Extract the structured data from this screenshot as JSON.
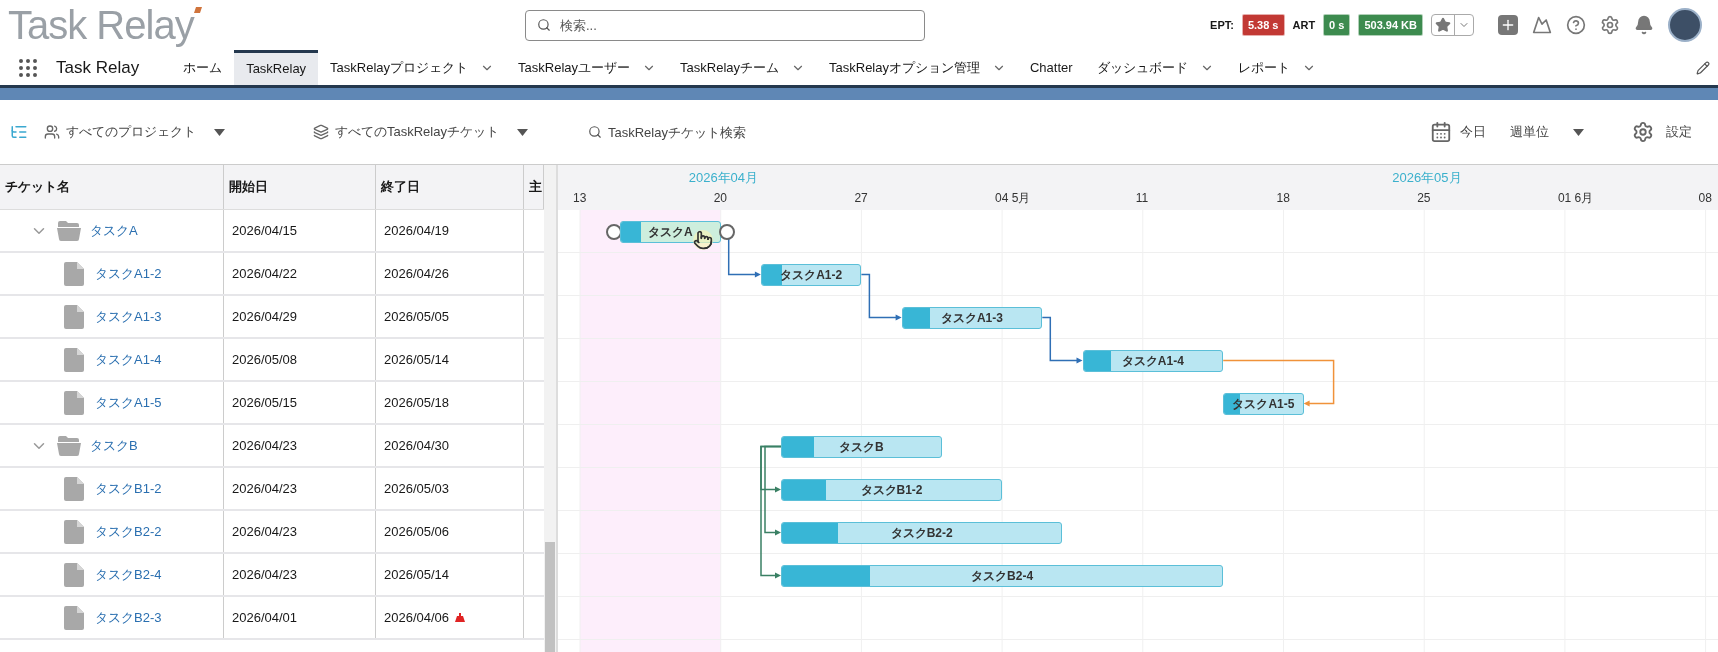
{
  "header": {
    "logo": "Task Relay",
    "search": {
      "placeholder": "検索..."
    },
    "metrics": [
      {
        "label": "EPT:",
        "value": "5.38 s",
        "color": "#c23934"
      },
      {
        "label": "ART",
        "value": "0 s",
        "color": "#3d8b4f"
      },
      {
        "value": "503.94 KB",
        "color": "#3d8b4f"
      }
    ]
  },
  "nav": {
    "app_name": "Task Relay",
    "items": [
      {
        "label": "ホーム",
        "selected": false,
        "has_menu": false
      },
      {
        "label": "TaskRelay",
        "selected": true,
        "has_menu": false
      },
      {
        "label": "TaskRelayプロジェクト",
        "selected": false,
        "has_menu": true
      },
      {
        "label": "TaskRelayユーザー",
        "selected": false,
        "has_menu": true
      },
      {
        "label": "TaskRelayチーム",
        "selected": false,
        "has_menu": true
      },
      {
        "label": "TaskRelayオプション管理",
        "selected": false,
        "has_menu": true
      },
      {
        "label": "Chatter",
        "selected": false,
        "has_menu": false
      },
      {
        "label": "ダッシュボード",
        "selected": false,
        "has_menu": true
      },
      {
        "label": "レポート",
        "selected": false,
        "has_menu": true
      }
    ]
  },
  "toolbar": {
    "project_filter": "すべてのプロジェクト",
    "ticket_filter": "すべてのTaskRelayチケット",
    "search": {
      "placeholder": "TaskRelayチケット検索"
    },
    "today": "今日",
    "scale": "週単位",
    "settings": "設定"
  },
  "table": {
    "columns": [
      "チケット名",
      "開始日",
      "終了日",
      "主"
    ],
    "rows": [
      {
        "name": "タスクA",
        "start": "2026/04/15",
        "end": "2026/04/19",
        "overdue": false,
        "expanded": true,
        "children": [
          {
            "name": "タスクA1-2",
            "start": "2026/04/22",
            "end": "2026/04/26",
            "overdue": false
          },
          {
            "name": "タスクA1-3",
            "start": "2026/04/29",
            "end": "2026/05/05",
            "overdue": false
          },
          {
            "name": "タスクA1-4",
            "start": "2026/05/08",
            "end": "2026/05/14",
            "overdue": false
          },
          {
            "name": "タスクA1-5",
            "start": "2026/05/15",
            "end": "2026/05/18",
            "overdue": false
          }
        ]
      },
      {
        "name": "タスクB",
        "start": "2026/04/23",
        "end": "2026/04/30",
        "overdue": false,
        "expanded": true,
        "children": [
          {
            "name": "タスクB1-2",
            "start": "2026/04/23",
            "end": "2026/05/03",
            "overdue": false
          },
          {
            "name": "タスクB2-2",
            "start": "2026/04/23",
            "end": "2026/05/06",
            "overdue": false
          },
          {
            "name": "タスクB2-4",
            "start": "2026/04/23",
            "end": "2026/05/14",
            "overdue": false
          },
          {
            "name": "タスクB2-3",
            "start": "2026/04/01",
            "end": "2026/04/06",
            "overdue": true
          }
        ]
      }
    ]
  },
  "gantt": {
    "months": [
      "2026年04月",
      "2026年05月"
    ],
    "weeks": [
      "13",
      "20",
      "27",
      "04 5月",
      "11",
      "18",
      "25",
      "01 6月",
      "08"
    ],
    "bars": [
      {
        "label": "タスクA",
        "level": 0.2,
        "hovered": true
      },
      {
        "label": "タスクA1-2",
        "level": 0.2,
        "hovered": false
      },
      {
        "label": "タスクA1-3",
        "level": 0.2,
        "hovered": false
      },
      {
        "label": "タスクA1-4",
        "level": 0.2,
        "hovered": false
      },
      {
        "label": "タスクA1-5",
        "level": 0.2,
        "hovered": false
      },
      {
        "label": "タスクB",
        "level": 0.2,
        "hovered": false
      },
      {
        "label": "タスクB1-2",
        "level": 0.2,
        "hovered": false
      },
      {
        "label": "タスクB2-2",
        "level": 0.2,
        "hovered": false
      },
      {
        "label": "タスクB2-4",
        "level": 0.2,
        "hovered": false
      }
    ]
  }
}
